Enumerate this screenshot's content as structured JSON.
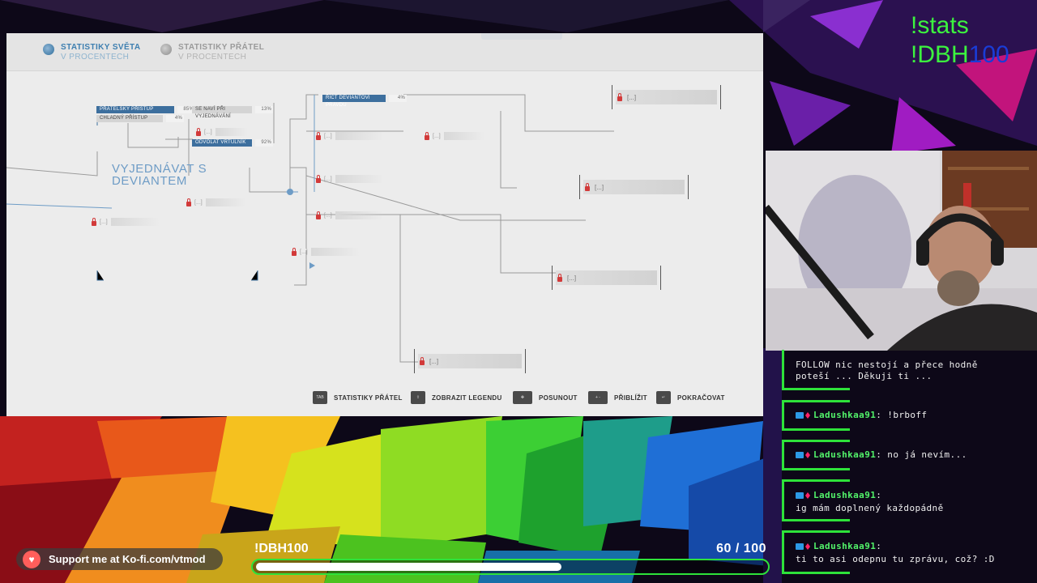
{
  "game": {
    "tab_world": {
      "line1": "STATISTIKY SVĚTA",
      "line2": "V PROCENTECH"
    },
    "tab_friends": {
      "line1": "STATISTIKY PŘÁTEL",
      "line2": "V PROCENTECH"
    },
    "heading": {
      "line1": "VYJEDNÁVAT S",
      "line2": "DEVIANTEM"
    },
    "nodes": {
      "friendly": {
        "label": "PŘÁTELSKÝ PŘÍSTUP",
        "pct": "85%"
      },
      "cold": {
        "label": "CHLADNÝ PŘÍSTUP",
        "pct": "4%"
      },
      "present": {
        "label": "SE NAVÍ PŘI VYJEDNÁVÁNÍ",
        "pct": "13%"
      },
      "recall": {
        "label": "ODVOLAT VRTULNÍK",
        "pct": "92%"
      },
      "truth": {
        "label": "ŘÍCT DEVIANTOVI PRAVDU",
        "pct": "4%"
      }
    },
    "locked_small": "[...]",
    "locked_big": "[...]",
    "footer": [
      {
        "key": "TAB",
        "label": "STATISTIKY PŘÁTEL"
      },
      {
        "key": "⇧",
        "label": "ZOBRAZIT LEGENDU"
      },
      {
        "key": "✥",
        "label": "POSUNOUT"
      },
      {
        "key": "+ -",
        "label": "PŘIBLÍŽIT"
      },
      {
        "key": "↵",
        "label": "POKRAČOVAT"
      }
    ]
  },
  "overlay": {
    "command1": "!stats",
    "command2_prefix": "!DBH",
    "command2_suffix": "100"
  },
  "chat": [
    {
      "text": "FOLLOW nic nestojí a přece hodně",
      "text2": "poteší ... Děkuji ti ..."
    },
    {
      "user": "Ladushkaa91",
      "text": ": !brboff"
    },
    {
      "user": "Ladushkaa91",
      "text": ": no já nevím..."
    },
    {
      "user": "Ladushkaa91",
      "text": ":",
      "text2": "ig mám doplnený každopádně"
    },
    {
      "user": "Ladushkaa91",
      "text": ":",
      "text2": "ti to asi odepnu tu zprávu, což? :D"
    }
  ],
  "kofi": {
    "label": "Support me at Ko-fi.com/vtmod"
  },
  "goal": {
    "title": "!DBH100",
    "current": "60",
    "separator": "/",
    "target": "100",
    "progress_fraction": 0.6
  },
  "colors": {
    "accent_green": "#2ee23a",
    "world_blue": "#3e7fb0",
    "lock_red": "#d23a3a"
  }
}
